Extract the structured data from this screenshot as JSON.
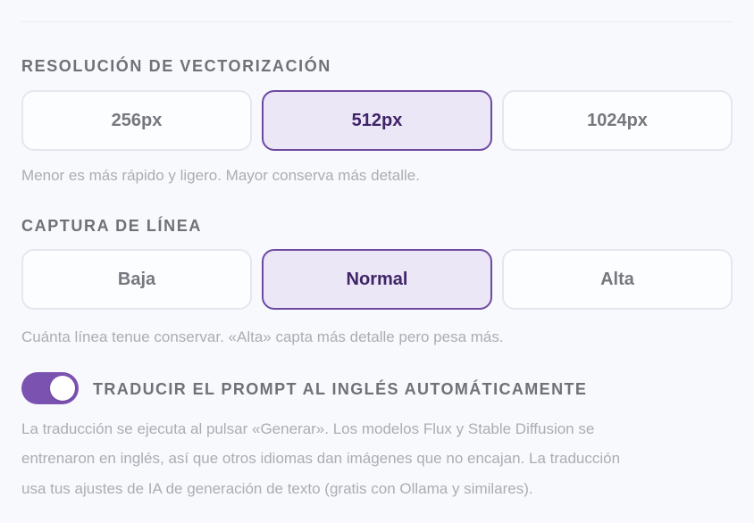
{
  "resolution": {
    "title": "RESOLUCIÓN DE VECTORIZACIÓN",
    "options": [
      "256px",
      "512px",
      "1024px"
    ],
    "selected": "512px",
    "hint": "Menor es más rápido y ligero. Mayor conserva más detalle."
  },
  "line_capture": {
    "title": "CAPTURA DE LÍNEA",
    "options": [
      "Baja",
      "Normal",
      "Alta"
    ],
    "selected": "Normal",
    "hint": "Cuánta línea tenue conservar. «Alta» capta más detalle pero pesa más."
  },
  "translate": {
    "enabled": true,
    "label": "TRADUCIR EL PROMPT AL INGLÉS AUTOMÁTICAMENTE",
    "description_lines": [
      "La traducción se ejecuta al pulsar «Generar». Los modelos Flux y Stable Diffusion se",
      "entrenaron en inglés, así que otros idiomas dan imágenes que no encajan. La traducción",
      "usa tus ajustes de IA de generación de texto (gratis con Ollama y similares)."
    ]
  },
  "colors": {
    "accent": "#7b52b0",
    "selected_border": "#6d4aa0",
    "selected_background": "#ebe7f6",
    "selected_text": "#3f2468",
    "muted_text": "#acadb3",
    "heading_text": "#707177",
    "background": "#f7f9fd"
  }
}
